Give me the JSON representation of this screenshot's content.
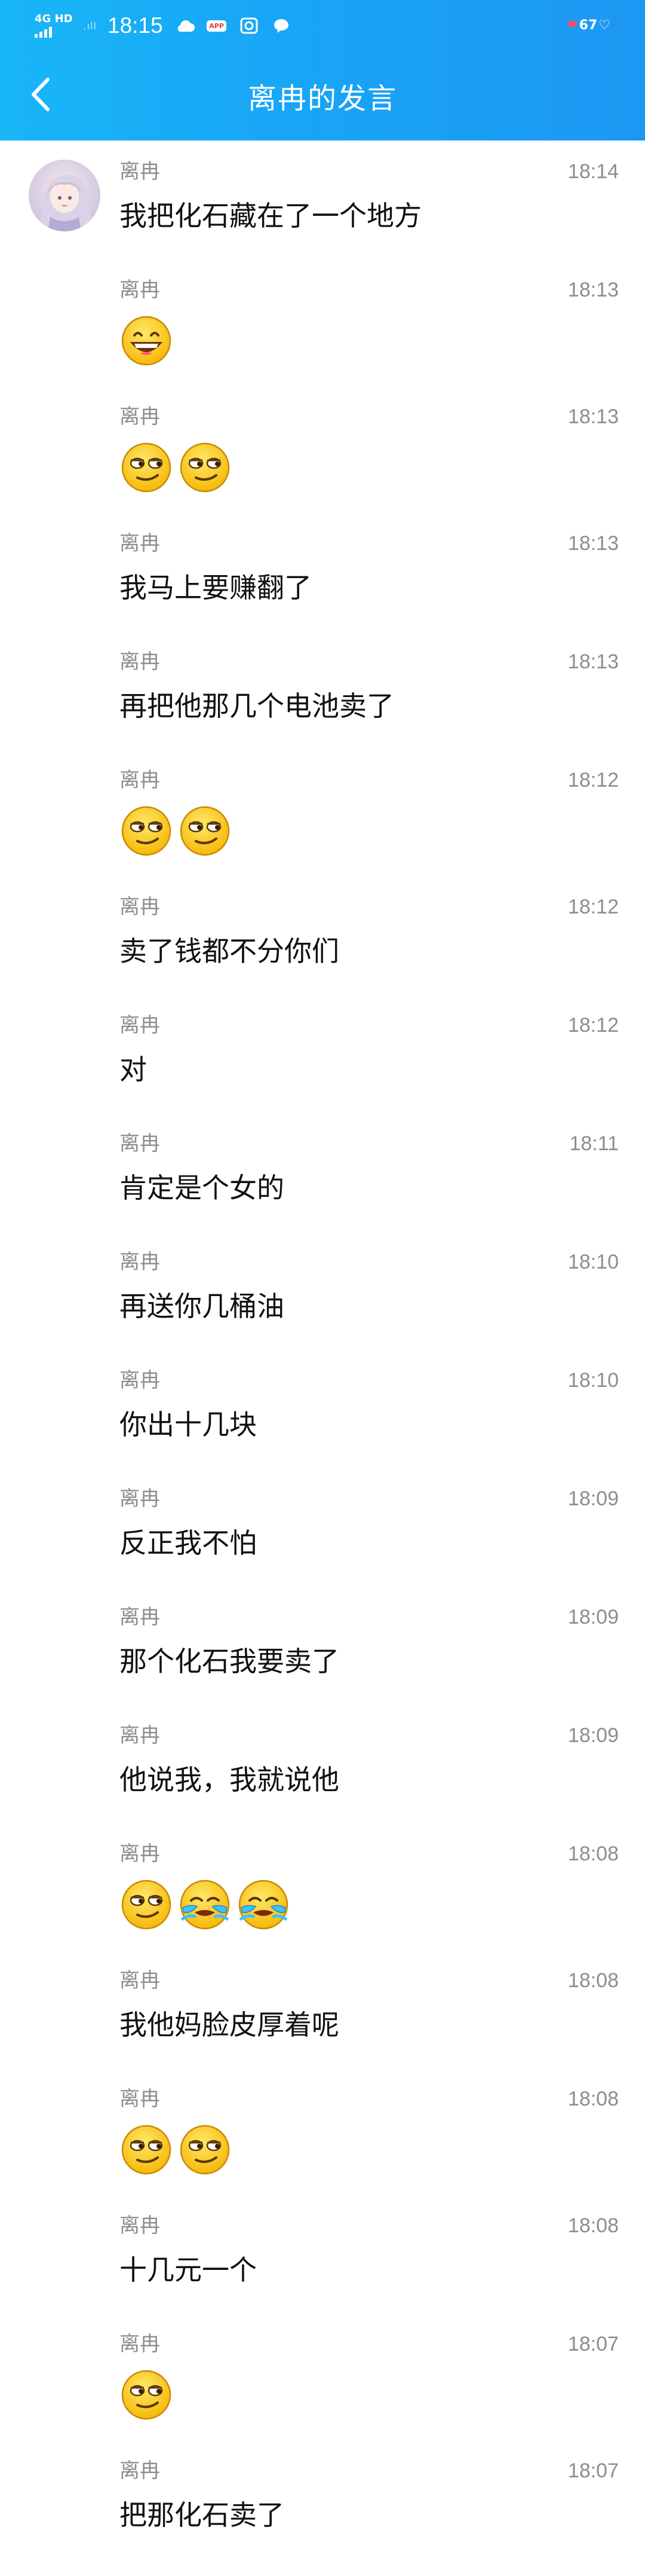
{
  "status_bar": {
    "network": "4G HD",
    "time": "18:15",
    "battery": "67",
    "icons": [
      "cloud-icon",
      "app-badge-icon",
      "camera-icon",
      "chat-bubble-icon"
    ]
  },
  "nav": {
    "title": "离冉的发言",
    "back_icon": "chevron-left-icon"
  },
  "messages": [
    {
      "name": "离冉",
      "time": "18:14",
      "text": "我把化石藏在了一个地方",
      "emojis": []
    },
    {
      "name": "离冉",
      "time": "18:13",
      "text": "",
      "emojis": [
        "grin"
      ]
    },
    {
      "name": "离冉",
      "time": "18:13",
      "text": "",
      "emojis": [
        "smirk",
        "smirk"
      ]
    },
    {
      "name": "离冉",
      "time": "18:13",
      "text": "我马上要赚翻了",
      "emojis": []
    },
    {
      "name": "离冉",
      "time": "18:13",
      "text": "再把他那几个电池卖了",
      "emojis": []
    },
    {
      "name": "离冉",
      "time": "18:12",
      "text": "",
      "emojis": [
        "smirk",
        "smirk"
      ]
    },
    {
      "name": "离冉",
      "time": "18:12",
      "text": "卖了钱都不分你们",
      "emojis": []
    },
    {
      "name": "离冉",
      "time": "18:12",
      "text": "对",
      "emojis": []
    },
    {
      "name": "离冉",
      "time": "18:11",
      "text": "肯定是个女的",
      "emojis": []
    },
    {
      "name": "离冉",
      "time": "18:10",
      "text": "再送你几桶油",
      "emojis": []
    },
    {
      "name": "离冉",
      "time": "18:10",
      "text": "你出十几块",
      "emojis": []
    },
    {
      "name": "离冉",
      "time": "18:09",
      "text": "反正我不怕",
      "emojis": []
    },
    {
      "name": "离冉",
      "time": "18:09",
      "text": "那个化石我要卖了",
      "emojis": []
    },
    {
      "name": "离冉",
      "time": "18:09",
      "text": "他说我，我就说他",
      "emojis": []
    },
    {
      "name": "离冉",
      "time": "18:08",
      "text": "",
      "emojis": [
        "smirk",
        "cry",
        "cry"
      ]
    },
    {
      "name": "离冉",
      "time": "18:08",
      "text": "我他妈脸皮厚着呢",
      "emojis": []
    },
    {
      "name": "离冉",
      "time": "18:08",
      "text": "",
      "emojis": [
        "smirk",
        "smirk"
      ]
    },
    {
      "name": "离冉",
      "time": "18:08",
      "text": "十几元一个",
      "emojis": []
    },
    {
      "name": "离冉",
      "time": "18:07",
      "text": "",
      "emojis": [
        "smirk"
      ]
    },
    {
      "name": "离冉",
      "time": "18:07",
      "text": "把那化石卖了",
      "emojis": []
    }
  ]
}
